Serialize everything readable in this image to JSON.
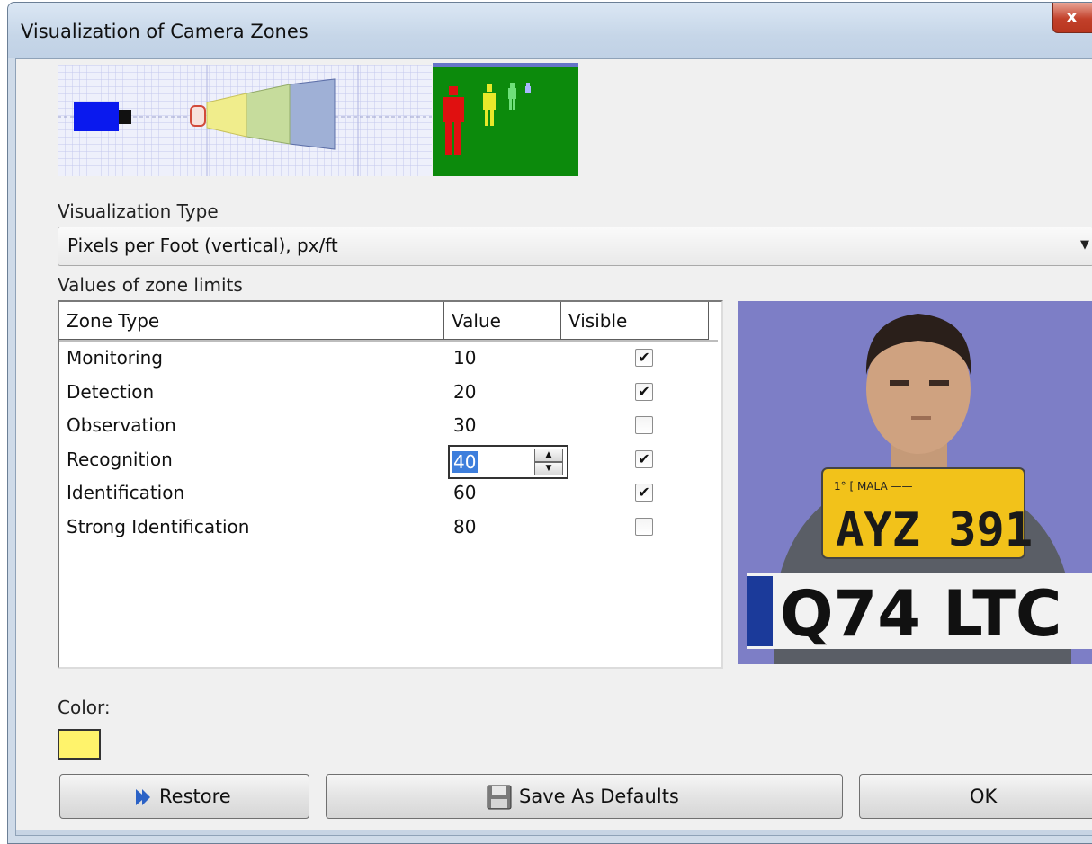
{
  "window": {
    "title": "Visualization of Camera Zones",
    "close_glyph": "x"
  },
  "visualization": {
    "type_label": "Visualization Type",
    "type_value": "Pixels per Foot (vertical), px/ft",
    "dropdown_icon": "chevron-down-icon"
  },
  "zones": {
    "section_label": "Values of zone limits",
    "columns": [
      "Zone Type",
      "Value",
      "Visible"
    ],
    "rows": [
      {
        "type": "Monitoring",
        "value": "10",
        "visible": true
      },
      {
        "type": "Detection",
        "value": "20",
        "visible": true
      },
      {
        "type": "Observation",
        "value": "30",
        "visible": false
      },
      {
        "type": "Recognition",
        "value": "40",
        "visible": true,
        "editing": true
      },
      {
        "type": "Identification",
        "value": "60",
        "visible": true
      },
      {
        "type": "Strong Identification",
        "value": "80",
        "visible": false
      }
    ]
  },
  "preview": {
    "plate_front": "AYZ 391",
    "plate_front_top": "1° [ MALA   ——",
    "plate_back": "Q74 LTC"
  },
  "color": {
    "label": "Color:",
    "value": "#fff36b"
  },
  "buttons": {
    "restore": "Restore",
    "save_defaults": "Save As Defaults",
    "ok": "OK"
  }
}
